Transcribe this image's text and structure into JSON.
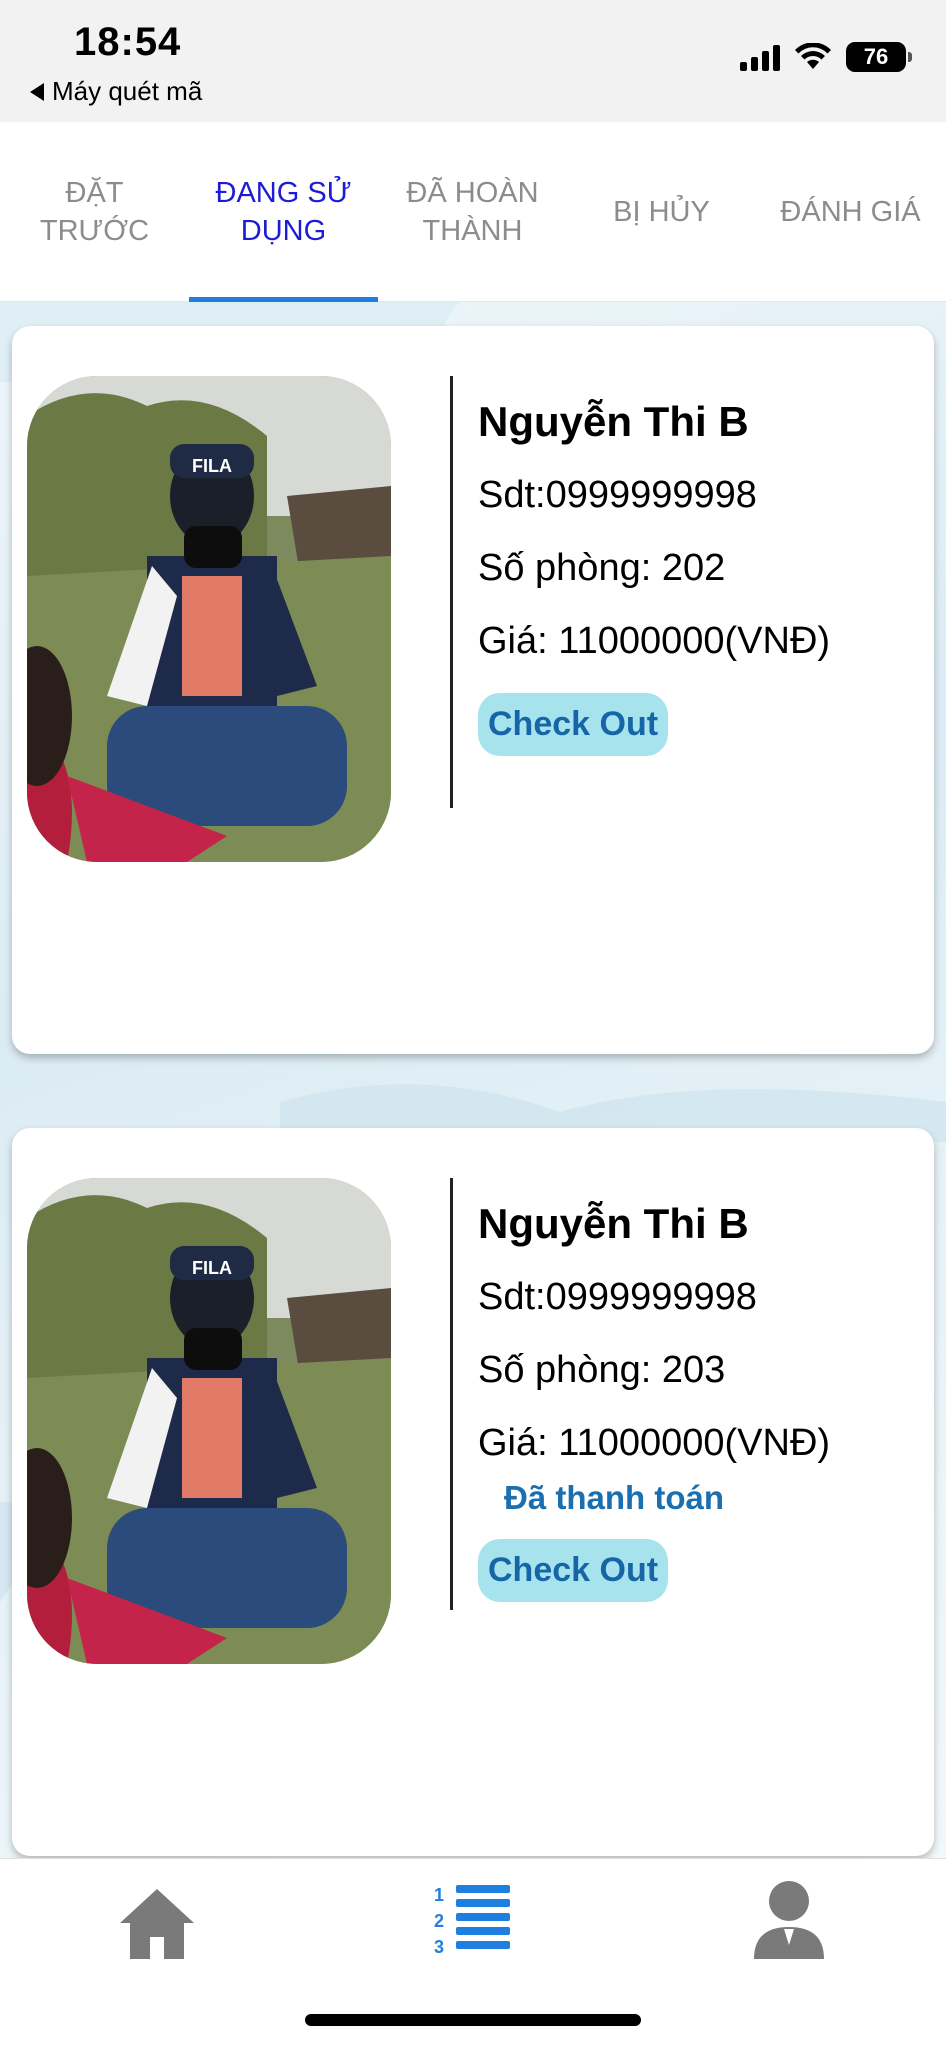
{
  "status_bar": {
    "time": "18:54",
    "back_app": "Máy quét mã",
    "battery": "76"
  },
  "tabs": [
    {
      "label": "ĐẶT TRƯỚC",
      "active": false
    },
    {
      "label": "ĐANG SỬ DỤNG",
      "active": true
    },
    {
      "label": "ĐÃ HOÀN THÀNH",
      "active": false
    },
    {
      "label": "BỊ HỦY",
      "active": false
    },
    {
      "label": "ĐÁNH GIÁ",
      "active": false
    }
  ],
  "bookings": [
    {
      "name": "Nguyễn Thi B",
      "phone": "Sdt:0999999998",
      "room": "Số phòng: 202",
      "price": "Giá: 11000000(VNĐ)",
      "payment_status": "",
      "button": "Check Out"
    },
    {
      "name": "Nguyễn Thi B",
      "phone": "Sdt:0999999998",
      "room": "Số phòng: 203",
      "price": "Giá: 11000000(VNĐ)",
      "payment_status": "Đã thanh toán",
      "button": "Check Out"
    }
  ],
  "bottom_nav": {
    "items": [
      "home-icon",
      "list-icon",
      "profile-icon"
    ],
    "active": "list-icon"
  },
  "colors": {
    "active_tab": "#1c1cd6",
    "tab_indicator": "#1e7fe0",
    "button_bg": "#a7e3ec",
    "button_text": "#1565a8",
    "nav_active": "#1e7fe0",
    "nav_inactive": "#7a7a7a"
  }
}
